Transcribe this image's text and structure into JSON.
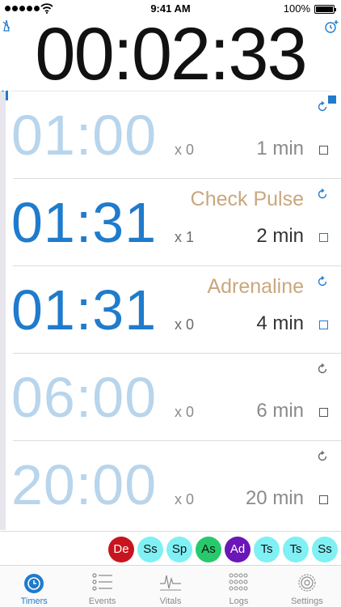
{
  "status_bar": {
    "time": "9:41 AM",
    "battery": "100%",
    "signal_dots": 5,
    "battery_level": 1.0
  },
  "main_timer": {
    "time": "00:02:33",
    "left_icon": "metronome-stop-icon",
    "right_icon": "add-timer-icon",
    "pause_icon": "pause-icon",
    "stop_icon": "stop-icon"
  },
  "timers": [
    {
      "time": "01:00",
      "count": "x 0",
      "label": "",
      "duration": "1 min",
      "style": "light",
      "repeat_color": "#1f7bcc"
    },
    {
      "time": "01:31",
      "count": "x 1",
      "label": "Check Pulse",
      "duration": "2 min",
      "style": "dark",
      "repeat_color": "#1f7bcc"
    },
    {
      "time": "01:31",
      "count": "x 0",
      "label": "Adrenaline",
      "duration": "4 min",
      "style": "dark",
      "repeat_color": "#1f7bcc"
    },
    {
      "time": "06:00",
      "count": "x 0",
      "label": "",
      "duration": "6 min",
      "style": "light",
      "repeat_color": "#666666"
    },
    {
      "time": "20:00",
      "count": "x 0",
      "label": "",
      "duration": "20 min",
      "style": "light",
      "repeat_color": "#666666"
    }
  ],
  "events": [
    {
      "label": "De",
      "color": "#c8141e",
      "text_color": "#ffffff"
    },
    {
      "label": "Ss",
      "color": "#7ff0f4",
      "text_color": "#111111"
    },
    {
      "label": "Sp",
      "color": "#7ff0f4",
      "text_color": "#111111"
    },
    {
      "label": "As",
      "color": "#27c96b",
      "text_color": "#111111"
    },
    {
      "label": "Ad",
      "color": "#6a16b8",
      "text_color": "#ffffff"
    },
    {
      "label": "Ts",
      "color": "#7ff0f4",
      "text_color": "#111111"
    },
    {
      "label": "Ts",
      "color": "#7ff0f4",
      "text_color": "#111111"
    },
    {
      "label": "Ss",
      "color": "#7ff0f4",
      "text_color": "#111111"
    }
  ],
  "tabs": [
    {
      "label": "Timers",
      "icon": "stopwatch-icon",
      "active": true
    },
    {
      "label": "Events",
      "icon": "list-icon",
      "active": false
    },
    {
      "label": "Vitals",
      "icon": "waveform-icon",
      "active": false
    },
    {
      "label": "Logs",
      "icon": "grid-dots-icon",
      "active": false
    },
    {
      "label": "Settings",
      "icon": "gear-icon",
      "active": false
    }
  ],
  "colors": {
    "accent": "#1f7bcc",
    "label_gold": "#c9a77d",
    "light_digits": "#b8d5ec"
  }
}
